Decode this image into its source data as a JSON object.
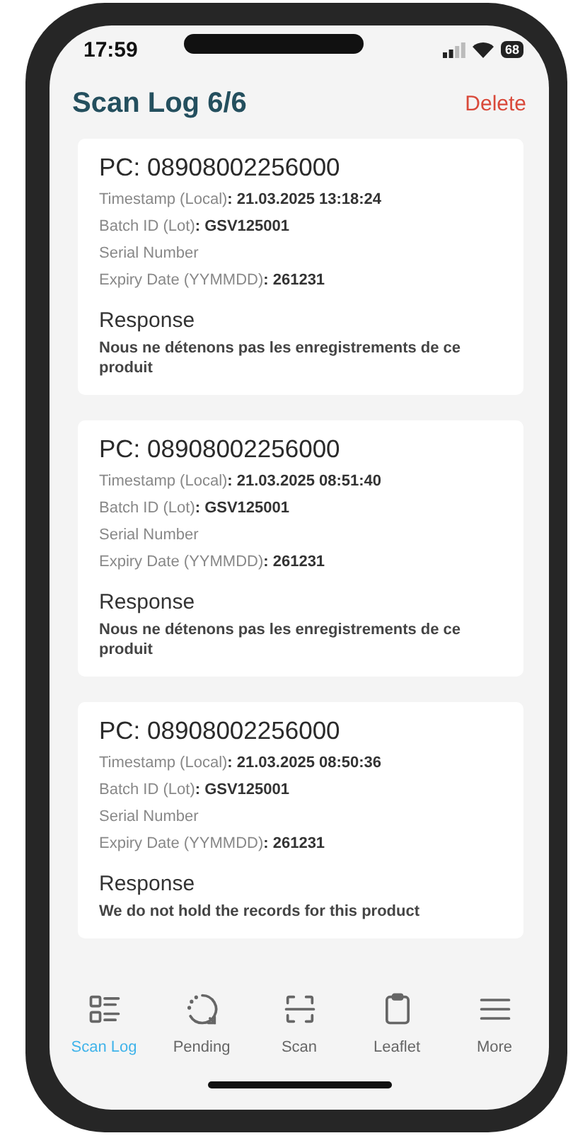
{
  "status_bar": {
    "time": "17:59",
    "battery": "68"
  },
  "header": {
    "title": "Scan Log 6/6",
    "action": "Delete"
  },
  "scans": [
    {
      "title": "PC: 08908002256000",
      "fields": [
        {
          "label": "Timestamp (Local)",
          "value": ": 21.03.2025 13:18:24"
        },
        {
          "label": "Batch ID (Lot)",
          "value": ": GSV125001"
        },
        {
          "label": "Serial Number"
        },
        {
          "label": "Expiry Date (YYMMDD)",
          "value": ": 261231"
        }
      ],
      "response_heading": "Response",
      "response": "Nous ne détenons pas les enregistrements de ce produit"
    },
    {
      "title": "PC: 08908002256000",
      "fields": [
        {
          "label": "Timestamp (Local)",
          "value": ": 21.03.2025 08:51:40"
        },
        {
          "label": "Batch ID (Lot)",
          "value": ": GSV125001"
        },
        {
          "label": "Serial Number"
        },
        {
          "label": "Expiry Date (YYMMDD)",
          "value": ": 261231"
        }
      ],
      "response_heading": "Response",
      "response": "Nous ne détenons pas les enregistrements de ce produit"
    },
    {
      "title": "PC: 08908002256000",
      "fields": [
        {
          "label": "Timestamp (Local)",
          "value": ": 21.03.2025 08:50:36"
        },
        {
          "label": "Batch ID (Lot)",
          "value": ": GSV125001"
        },
        {
          "label": "Serial Number"
        },
        {
          "label": "Expiry Date (YYMMDD)",
          "value": ": 261231"
        }
      ],
      "response_heading": "Response",
      "response": "We do not hold the records for this product"
    }
  ],
  "tab_bar": [
    {
      "kind": "list",
      "label": "Scan Log",
      "selected": true
    },
    {
      "kind": "pending",
      "label": "Pending",
      "selected": false
    },
    {
      "kind": "scan",
      "label": "Scan",
      "selected": false
    },
    {
      "kind": "clipboard",
      "label": "Leaflet",
      "selected": false
    },
    {
      "kind": "menu",
      "label": "More",
      "selected": false
    }
  ]
}
